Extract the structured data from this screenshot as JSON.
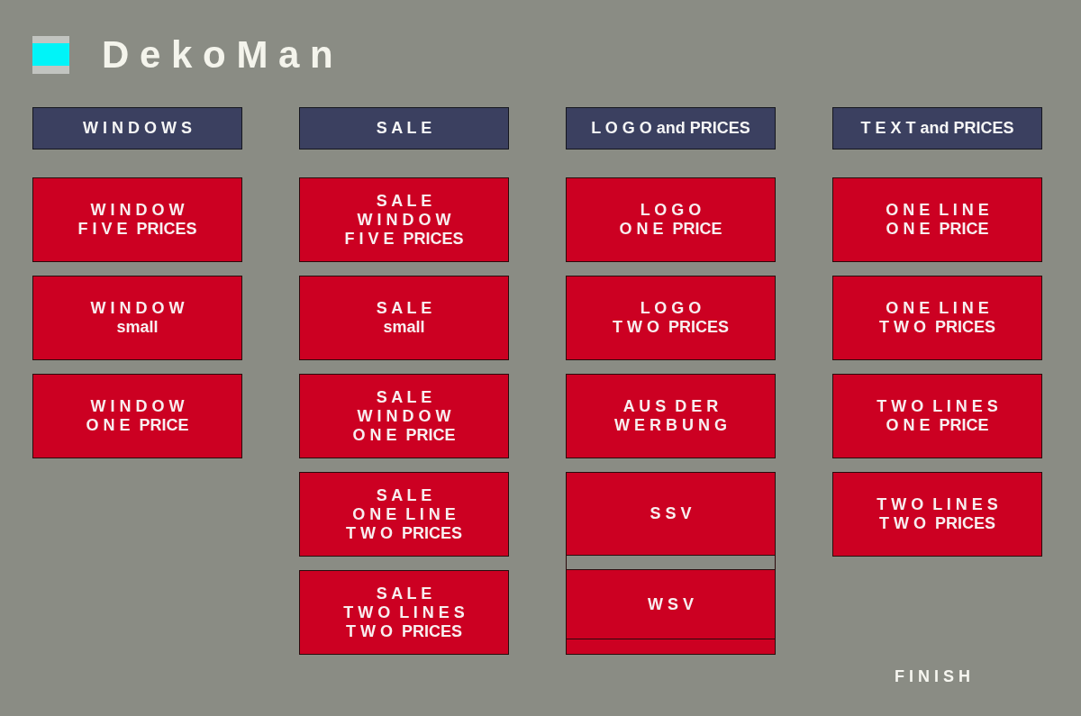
{
  "app": {
    "title": "D e k o M a n"
  },
  "columns": [
    {
      "heading": "W I N D O W S",
      "items": [
        {
          "kind": "button",
          "label": "W I N D O W\nF I V E  PRICES"
        },
        {
          "kind": "button",
          "label": "W I N D O W\nsmall"
        },
        {
          "kind": "button",
          "label": "W I N D O W\nO N E  PRICE"
        }
      ]
    },
    {
      "heading": "S A L E",
      "items": [
        {
          "kind": "button",
          "label": "S A L E\nW I N D O W\nF I V E  PRICES"
        },
        {
          "kind": "button",
          "label": "S A L E\nsmall"
        },
        {
          "kind": "button",
          "label": "S A L E\nW I N D O W\nO N E  PRICE"
        },
        {
          "kind": "button",
          "label": "S A L E\nO N E  L I N E\nT W O  PRICES"
        },
        {
          "kind": "button",
          "label": "S A L E\nT W O  L I N E S\nT W O  PRICES"
        }
      ]
    },
    {
      "heading": "L O G O and PRICES",
      "items": [
        {
          "kind": "button",
          "label": "L O G O\nO N E  PRICE"
        },
        {
          "kind": "button",
          "label": "L O G O\nT W O  PRICES"
        },
        {
          "kind": "button",
          "label": "A U S  D E R\nW E R B U N G"
        },
        {
          "kind": "pair",
          "items": [
            {
              "label": "S S V"
            },
            {
              "label": "W S V"
            }
          ]
        }
      ]
    },
    {
      "heading": "T E X T and PRICES",
      "items": [
        {
          "kind": "button",
          "label": "O N E  L I N E\nO N E  PRICE"
        },
        {
          "kind": "button",
          "label": "O N E  L I N E\nT W O  PRICES"
        },
        {
          "kind": "button",
          "label": "T W O  L I N E S\nO N E  PRICE"
        },
        {
          "kind": "button",
          "label": "T W O  L I N E S\nT W O  PRICES"
        }
      ]
    }
  ],
  "finish": {
    "label": "F I N I S H"
  }
}
